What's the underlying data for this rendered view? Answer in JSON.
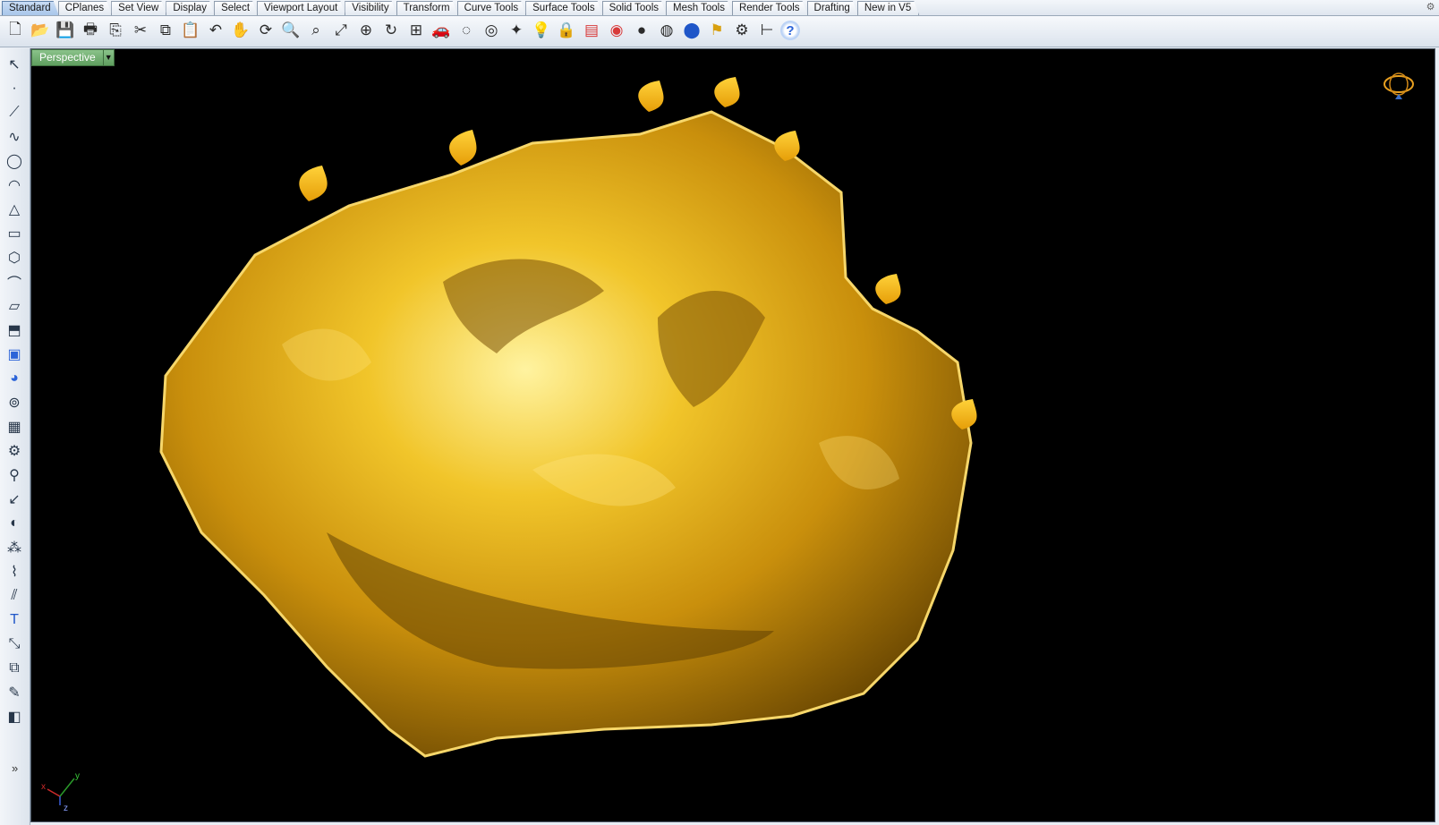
{
  "tabs": [
    "Standard",
    "CPlanes",
    "Set View",
    "Display",
    "Select",
    "Viewport Layout",
    "Visibility",
    "Transform",
    "Curve Tools",
    "Surface Tools",
    "Solid Tools",
    "Mesh Tools",
    "Render Tools",
    "Drafting",
    "New in V5"
  ],
  "active_tab": "Standard",
  "viewport": {
    "title": "Perspective",
    "axis_labels": {
      "x": "x",
      "y": "y",
      "z": "z"
    },
    "background_color": "#000000",
    "model_color": "#e3b21c"
  },
  "toolbar_icons": [
    "new-file-icon",
    "open-folder-icon",
    "save-icon",
    "print-icon",
    "import-icon",
    "cut-icon",
    "copy-icon",
    "paste-icon",
    "undo-icon",
    "pan-hand-icon",
    "rotate-view-icon",
    "zoom-icon",
    "zoom-window-icon",
    "zoom-extents-icon",
    "zoom-selected-icon",
    "rotate-camera-icon",
    "four-viewports-icon",
    "car-icon",
    "hide-icon",
    "show-icon",
    "select-light-icon",
    "lightbulb-icon",
    "lock-icon",
    "layers-icon",
    "color-wheel-icon",
    "shaded-sphere-icon",
    "rendered-sphere-icon",
    "render-blue-sphere-icon",
    "flag-icon",
    "gear-options-icon",
    "dimension-icon",
    "help-icon"
  ],
  "sidebar_icons": [
    "select-arrow-icon",
    "point-icon",
    "polyline-icon",
    "curve-icon",
    "circle-icon",
    "arc-icon",
    "triangle-icon",
    "rectangle-icon",
    "polygon-icon",
    "fillet-icon",
    "surface-icon",
    "extrude-icon",
    "box-icon",
    "sphere-icon",
    "cylinder-icon",
    "mesh-icon",
    "gear-transform-icon",
    "analyze-icon",
    "curve-from-object-icon",
    "boolean-icon",
    "array-icon",
    "blend-icon",
    "offset-icon",
    "text-icon",
    "scale-icon",
    "group-icon",
    "edit-icon",
    "solid-box-icon"
  ],
  "sidebar_more": "»"
}
